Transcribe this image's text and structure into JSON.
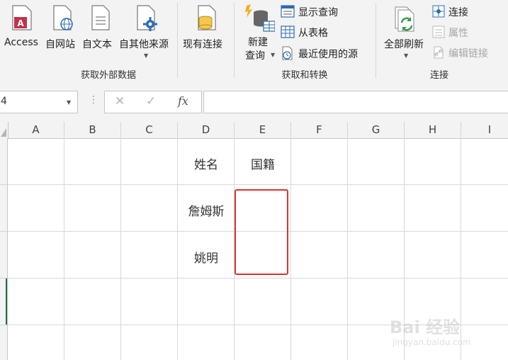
{
  "ribbon": {
    "get_external": {
      "group_label": "获取外部数据",
      "access": "Access",
      "web": "自网站",
      "text": "自文本",
      "other": "自其他来源"
    },
    "existing_conn": "现有连接",
    "get_transform": {
      "group_label": "获取和转换",
      "new_query_line1": "新建",
      "new_query_line2": "查询",
      "show_queries": "显示查询",
      "from_table": "从表格",
      "recent_sources": "最近使用的源"
    },
    "connections": {
      "group_label": "连接",
      "refresh_all": "全部刷新",
      "connections": "连接",
      "properties": "属性",
      "edit_links": "编辑链接"
    }
  },
  "formula_bar": {
    "name_box": "4",
    "cancel_glyph": "✕",
    "enter_glyph": "✓",
    "fx": "fx",
    "formula": ""
  },
  "columns": [
    "A",
    "B",
    "C",
    "D",
    "E",
    "F",
    "G",
    "H",
    "I"
  ],
  "cells": {
    "d1": "姓名",
    "e1": "国籍",
    "d2": "詹姆斯",
    "d3": "姚明"
  },
  "colors": {
    "selection_border": "#e03131",
    "access_red": "#c4314b",
    "refresh_green": "#3a9a4a",
    "icon_blue": "#2b6cb0",
    "row_active_marker": "#217346"
  },
  "watermark": {
    "main": "Bai 经验",
    "url": "jingyan.baidu.com"
  }
}
